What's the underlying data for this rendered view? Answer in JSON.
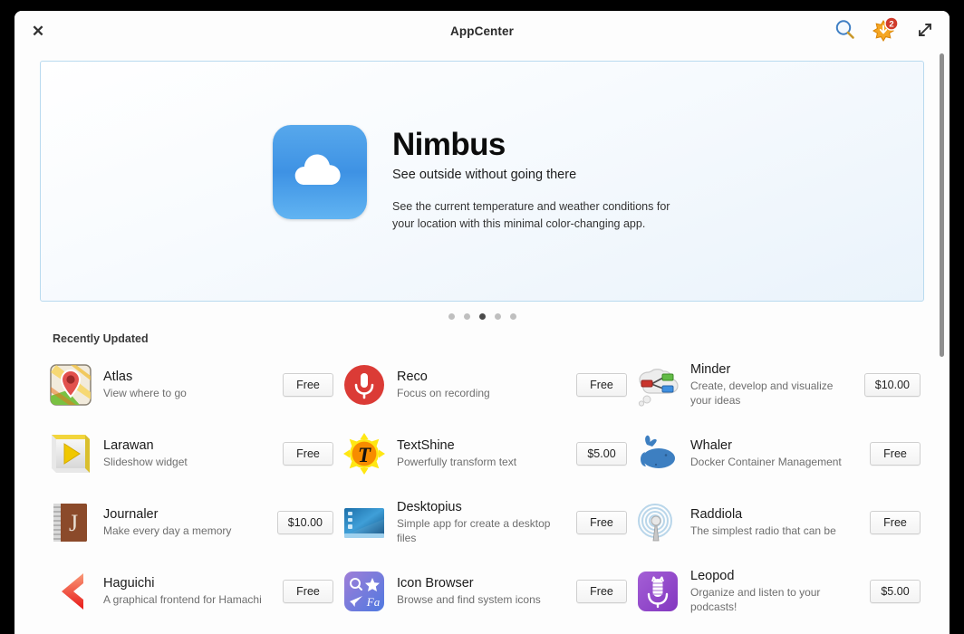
{
  "window": {
    "title": "AppCenter",
    "close_label": "✕"
  },
  "header": {
    "search_icon": "search-icon",
    "updates_icon": "updates-starburst-icon",
    "updates_badge": "2",
    "fullscreen_icon": "expand-icon"
  },
  "banner": {
    "icon": "cloud-icon",
    "title": "Nimbus",
    "subtitle": "See outside without going there",
    "description": "See the current temperature and weather conditions for your location with this minimal color-changing app.",
    "dots": [
      {
        "active": false
      },
      {
        "active": false
      },
      {
        "active": true
      },
      {
        "active": false
      },
      {
        "active": false
      }
    ]
  },
  "section": {
    "title": "Recently Updated"
  },
  "apps": [
    {
      "name": "Atlas",
      "desc": "View where to go",
      "price": "Free",
      "icon": "atlas-map-icon"
    },
    {
      "name": "Reco",
      "desc": "Focus on recording",
      "price": "Free",
      "icon": "reco-microphone-icon"
    },
    {
      "name": "Minder",
      "desc": "Create, develop and visualize your ideas",
      "price": "$10.00",
      "icon": "minder-mindmap-icon"
    },
    {
      "name": "Larawan",
      "desc": "Slideshow widget",
      "price": "Free",
      "icon": "larawan-play-icon"
    },
    {
      "name": "TextShine",
      "desc": "Powerfully transform text",
      "price": "$5.00",
      "icon": "textshine-sun-t-icon"
    },
    {
      "name": "Whaler",
      "desc": "Docker Container Management",
      "price": "Free",
      "icon": "whaler-whale-icon"
    },
    {
      "name": "Journaler",
      "desc": "Make every day a memory",
      "price": "$10.00",
      "icon": "journaler-notebook-icon"
    },
    {
      "name": "Desktopius",
      "desc": "Simple app for create a desktop files",
      "price": "Free",
      "icon": "desktopius-screen-icon"
    },
    {
      "name": "Raddiola",
      "desc": "The simplest radio that can be",
      "price": "Free",
      "icon": "raddiola-antenna-icon"
    },
    {
      "name": "Haguichi",
      "desc": "A graphical frontend for Hamachi",
      "price": "Free",
      "icon": "haguichi-chevron-icon"
    },
    {
      "name": "Icon Browser",
      "desc": "Browse and find system icons",
      "price": "Free",
      "icon": "icon-browser-glyphs-icon"
    },
    {
      "name": "Leopod",
      "desc": "Organize and listen to your podcasts!",
      "price": "$5.00",
      "icon": "leopod-microphone-icon"
    }
  ],
  "colors": {
    "accent": "#3e92e4",
    "badge": "#d03a2a",
    "banner_border": "#b9daef"
  }
}
